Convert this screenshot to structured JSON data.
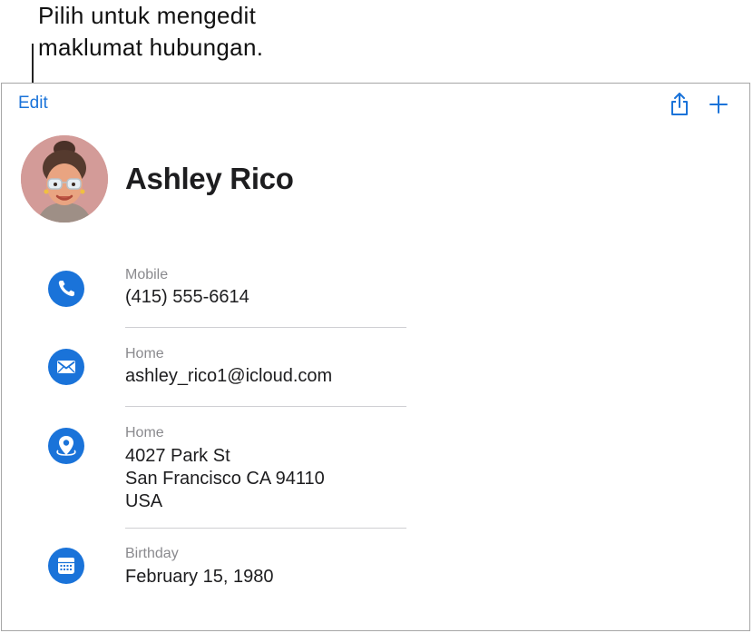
{
  "callout": {
    "line1": "Pilih untuk mengedit",
    "line2": "maklumat hubungan."
  },
  "toolbar": {
    "edit_label": "Edit",
    "share_icon": "share-icon",
    "add_icon": "plus-icon"
  },
  "contact": {
    "name": "Ashley Rico",
    "avatar": "memoji-avatar"
  },
  "fields": [
    {
      "label": "Mobile",
      "lines": [
        "(415) 555-6614"
      ],
      "icon": "phone-icon"
    },
    {
      "label": "Home",
      "lines": [
        "ashley_rico1@icloud.com"
      ],
      "icon": "envelope-icon"
    },
    {
      "label": "Home",
      "lines": [
        "4027 Park St",
        "San Francisco CA 94110",
        "USA"
      ],
      "icon": "map-pin-icon"
    },
    {
      "label": "Birthday",
      "lines": [
        "February 15, 1980"
      ],
      "icon": "calendar-icon"
    }
  ],
  "colors": {
    "accent": "#1a73d9",
    "label": "#8a8a8e",
    "divider": "#cfcfd3",
    "avatar_bg": "#d39b98"
  }
}
